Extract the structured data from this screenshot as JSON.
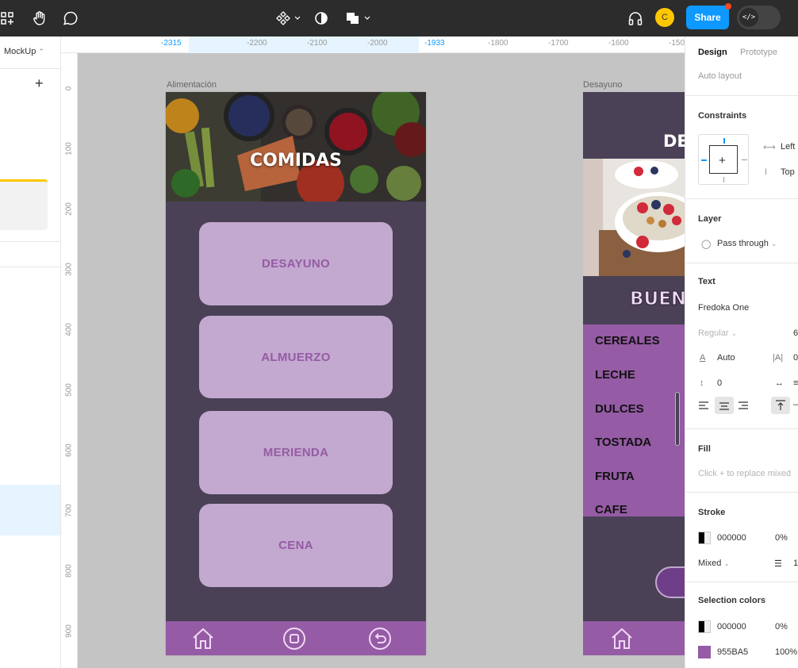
{
  "toolbar": {
    "share_label": "Share",
    "avatar_initial": "C",
    "icons": [
      "frame-tool-icon",
      "hand-tool-icon",
      "comment-tool-icon",
      "components-icon",
      "mask-icon",
      "boolean-icon",
      "headphones-icon",
      "code-icon"
    ]
  },
  "left_panel": {
    "page_label": "MockUp",
    "add_label": "+"
  },
  "ruler": {
    "top": [
      "-2315",
      "-2200",
      "-2100",
      "-2000",
      "-1933",
      "-1800",
      "-1700",
      "-1600",
      "-150"
    ],
    "left": [
      "0",
      "100",
      "200",
      "300",
      "400",
      "500",
      "600",
      "700",
      "800",
      "900"
    ]
  },
  "frame1": {
    "label": "Alimentación",
    "hero_title": "COMIDAS",
    "buttons": [
      "DESAYUNO",
      "ALMUERZO",
      "MERIENDA",
      "CENA"
    ],
    "nav_icons": [
      "home-icon",
      "stop-icon",
      "return-icon"
    ]
  },
  "frame2": {
    "label": "Desayuno",
    "title_partial": "DE",
    "banner_partial": "BUEN",
    "items": [
      "CEREALES",
      "LECHE",
      "DULCES",
      "TOSTADA",
      "FRUTA",
      "CAFE"
    ]
  },
  "right_panel": {
    "tabs": {
      "design": "Design",
      "prototype": "Prototype"
    },
    "auto_layout": "Auto layout",
    "constraints": {
      "title": "Constraints",
      "horizontal": "Left",
      "vertical": "Top"
    },
    "layer": {
      "title": "Layer",
      "blend": "Pass through"
    },
    "text": {
      "title": "Text",
      "font": "Fredoka One",
      "weight": "Regular",
      "size_partial": "6",
      "line_height": "Auto",
      "letter_spacing": "0",
      "paragraph_spacing": "0",
      "letter_label": "|A|"
    },
    "fill": {
      "title": "Fill",
      "hint": "Click + to replace mixed"
    },
    "stroke": {
      "title": "Stroke",
      "color": "000000",
      "opacity": "0%",
      "weight_label": "Mixed",
      "weight_value": "1"
    },
    "selection_colors": {
      "title": "Selection colors",
      "colors": [
        {
          "hex": "000000",
          "opacity": "0%"
        },
        {
          "hex": "955BA5",
          "opacity": "100%"
        }
      ]
    }
  },
  "colors": {
    "accent": "#0d99ff",
    "purple": "#955ba5",
    "button": "#c3a8cf",
    "frame_bg": "#4a4156"
  }
}
